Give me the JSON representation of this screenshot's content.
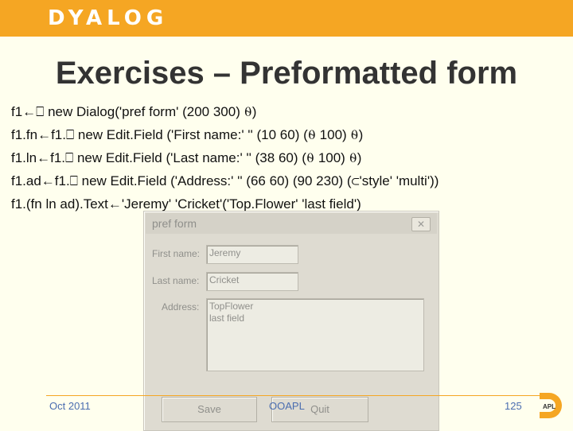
{
  "brand": {
    "logo_text": "DYALOG",
    "accent": "#f5a623"
  },
  "slide": {
    "title": "Exercises – Preformatted form",
    "code_lines": [
      "f1←⎕ new Dialog('pref form' (200 300) ⍬)",
      "f1.fn←f1.⎕ new Edit.Field ('First name:' '' (10 60) (⍬ 100) ⍬)",
      "f1.ln←f1.⎕ new Edit.Field ('Last name:' '' (38 60) (⍬ 100) ⍬)",
      "f1.ad←f1.⎕ new Edit.Field ('Address:' '' (66 60) (90 230) (⊂'style' 'multi'))",
      "f1.(fn ln ad).Text←'Jeremy' 'Cricket'('Top.Flower' 'last field')"
    ]
  },
  "dialog": {
    "title": "pref form",
    "close_glyph": "✕",
    "first_name_label": "First name:",
    "first_name_value": "Jeremy",
    "last_name_label": "Last name:",
    "last_name_value": "Cricket",
    "address_label": "Address:",
    "address_value": "TopFlower\nlast field",
    "save_label": "Save",
    "quit_label": "Quit"
  },
  "footer": {
    "date": "Oct 2011",
    "center": "OOAPL",
    "page": "125",
    "logo_text": "APL"
  }
}
